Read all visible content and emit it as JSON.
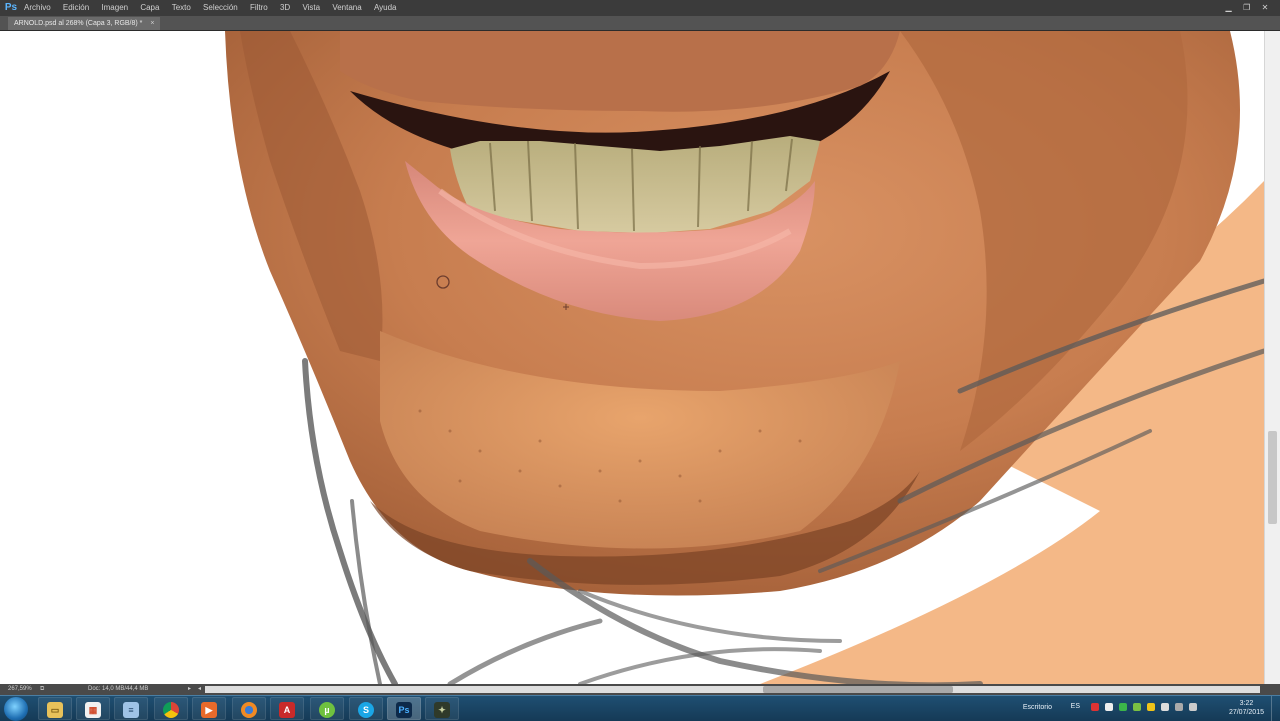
{
  "app": {
    "logo_text": "Ps",
    "menu": [
      "Archivo",
      "Edición",
      "Imagen",
      "Capa",
      "Texto",
      "Selección",
      "Filtro",
      "3D",
      "Vista",
      "Ventana",
      "Ayuda"
    ]
  },
  "document": {
    "tab_title": "ARNOLD.psd al 268% (Capa 3, RGB/8) *",
    "tab_close": "×"
  },
  "status": {
    "zoom": "267,59%",
    "doc_info": "Doc: 14,0 MB/44,4 MB",
    "arrow": "▸",
    "arrow_left": "◂"
  },
  "taskbar": {
    "apps": [
      "file-explorer",
      "windows-store-tiles",
      "notepad",
      "chrome",
      "media-player",
      "firefox",
      "acrobat",
      "utorrent",
      "skype",
      "photoshop",
      "game"
    ],
    "escritorio_label": "Escritorio",
    "language": "ES",
    "time": "3:22",
    "date": "27/07/2015"
  },
  "window_controls": [
    "minimize",
    "restore",
    "close"
  ],
  "colors": {
    "menubar": "#3b3b3b",
    "skin": "#e8a46c",
    "lip": "#e79a8d",
    "teeth": "#cbbf8e"
  }
}
